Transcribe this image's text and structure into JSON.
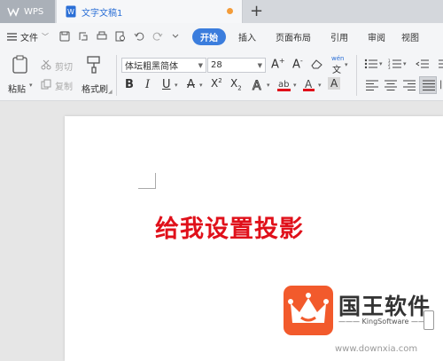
{
  "titlebar": {
    "app_tab": "WPS",
    "doc_tab": "文字文稿1",
    "new_tab": "+"
  },
  "menubar": {
    "file_label": "文件",
    "tabs": [
      "开始",
      "插入",
      "页面布局",
      "引用",
      "审阅",
      "视图"
    ],
    "active_tab": "开始"
  },
  "ribbon": {
    "paste": "粘贴",
    "cut": "剪切",
    "copy": "复制",
    "format_painter": "格式刷",
    "font_name": "体坛粗黑简体",
    "font_size": "28",
    "pinyin": "wén"
  },
  "document": {
    "text": "给我设置投影",
    "text_color": "#e0101a"
  },
  "watermark": {
    "title": "国王软件",
    "subtitle": "KingSoftware",
    "url": "www.downxia.com",
    "logo_color": "#f25a2c"
  },
  "colors": {
    "accent": "#3b7ddd",
    "tab_dot": "#f39c3a"
  }
}
